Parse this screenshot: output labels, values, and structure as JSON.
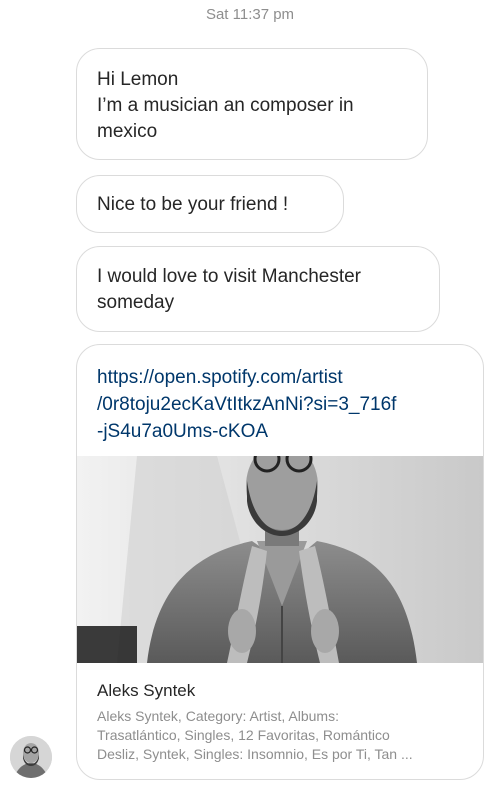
{
  "thread": {
    "timestamp": "Sat 11:37 pm"
  },
  "messages": [
    {
      "lines": [
        "Hi Lemon",
        "I’m a musician an composer in",
        "mexico"
      ]
    },
    {
      "lines": [
        "Nice to be your friend !"
      ]
    },
    {
      "lines": [
        "I would love to visit Manchester",
        "someday"
      ]
    }
  ],
  "link_card": {
    "url_lines": [
      "https://open.spotify.com/artist",
      "/0r8toju2ecKaVtItkzAnNi?si=3_716f",
      "-jS4u7a0Ums-cKOA"
    ],
    "title": "Aleks Syntek",
    "description_lines": [
      "Aleks Syntek, Category: Artist, Albums:",
      "Trasatlántico, Singles, 12 Favoritas, Romántico",
      "Desliz, Syntek, Singles: Insomnio, Es por Ti, Tan ..."
    ]
  }
}
